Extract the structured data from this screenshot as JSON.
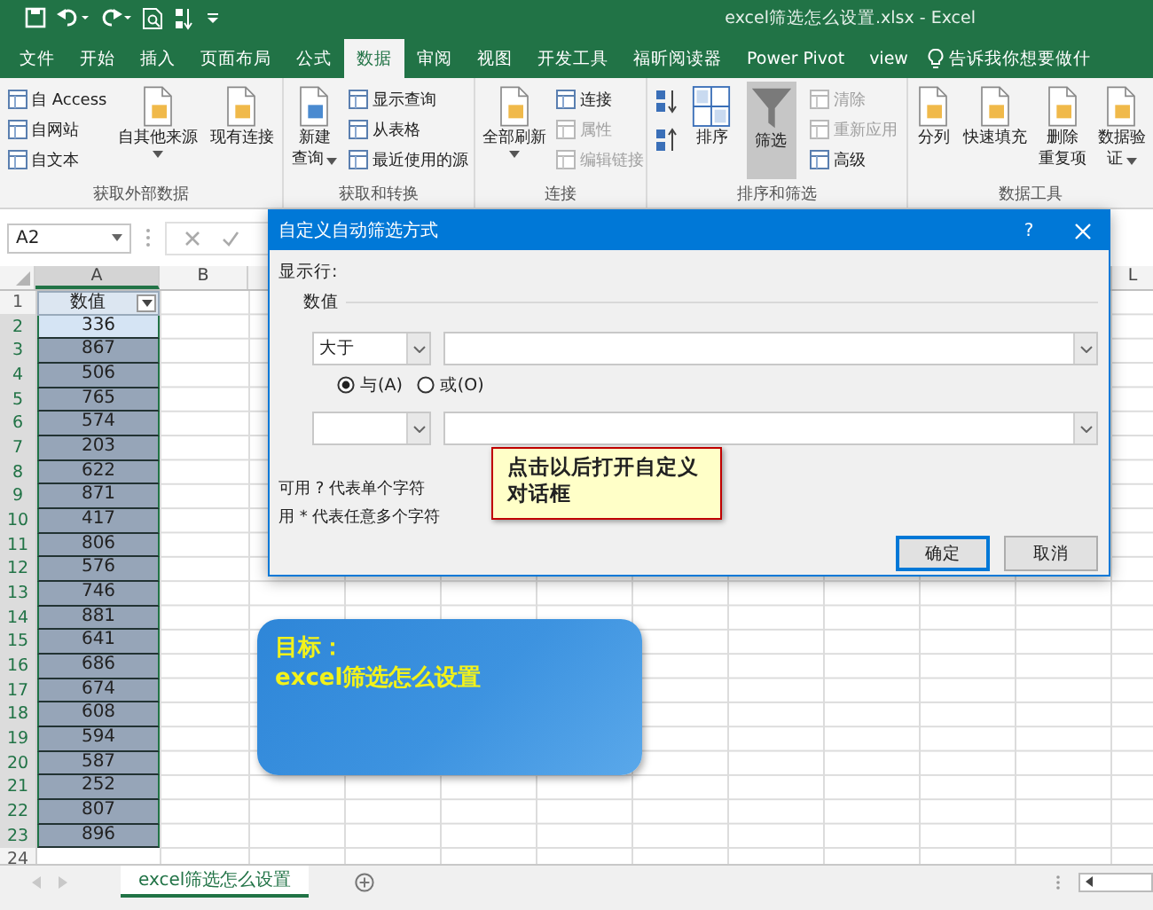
{
  "title": "excel筛选怎么设置.xlsx  -  Excel",
  "menu_tabs": [
    {
      "label": "文件",
      "selected": false
    },
    {
      "label": "开始",
      "selected": false
    },
    {
      "label": "插入",
      "selected": false
    },
    {
      "label": "页面布局",
      "selected": false
    },
    {
      "label": "公式",
      "selected": false
    },
    {
      "label": "数据",
      "selected": true
    },
    {
      "label": "审阅",
      "selected": false
    },
    {
      "label": "视图",
      "selected": false
    },
    {
      "label": "开发工具",
      "selected": false
    },
    {
      "label": "福昕阅读器",
      "selected": false
    },
    {
      "label": "Power Pivot",
      "selected": false
    },
    {
      "label": "view",
      "selected": false
    }
  ],
  "tell_me": "告诉我你想要做什",
  "ribbon_groups": [
    {
      "label": "获取外部数据",
      "buttons": [
        {
          "kind": "small",
          "lines": [
            "自 Access"
          ],
          "disabled": false
        },
        {
          "kind": "small",
          "lines": [
            "自网站"
          ],
          "disabled": false
        },
        {
          "kind": "small",
          "lines": [
            "自文本"
          ],
          "disabled": false
        },
        {
          "kind": "large",
          "lines": [
            "自其他来源"
          ],
          "dropdown": true,
          "disabled": false
        },
        {
          "kind": "large",
          "lines": [
            "现有连接"
          ],
          "disabled": false
        }
      ]
    },
    {
      "label": "获取和转换",
      "buttons": [
        {
          "kind": "large",
          "lines": [
            "新建",
            "查询"
          ],
          "dropdown": true,
          "disabled": false
        },
        {
          "kind": "small",
          "lines": [
            "显示查询"
          ],
          "disabled": false
        },
        {
          "kind": "small",
          "lines": [
            "从表格"
          ],
          "disabled": false
        },
        {
          "kind": "small",
          "lines": [
            "最近使用的源"
          ],
          "disabled": false
        }
      ]
    },
    {
      "label": "连接",
      "buttons": [
        {
          "kind": "large",
          "lines": [
            "全部刷新"
          ],
          "dropdown": true,
          "disabled": false
        },
        {
          "kind": "small",
          "lines": [
            "连接"
          ],
          "disabled": false
        },
        {
          "kind": "small",
          "lines": [
            "属性"
          ],
          "disabled": true
        },
        {
          "kind": "small",
          "lines": [
            "编辑链接"
          ],
          "disabled": true
        }
      ]
    },
    {
      "label": "排序和筛选",
      "buttons": [
        {
          "kind": "sort-pair"
        },
        {
          "kind": "sort",
          "lines": [
            "排序"
          ],
          "disabled": false
        },
        {
          "kind": "filter",
          "lines": [
            "筛选"
          ],
          "selected": true,
          "disabled": false
        },
        {
          "kind": "small",
          "lines": [
            "清除"
          ],
          "disabled": true
        },
        {
          "kind": "small",
          "lines": [
            "重新应用"
          ],
          "disabled": true
        },
        {
          "kind": "small",
          "lines": [
            "高级"
          ],
          "disabled": false
        }
      ]
    },
    {
      "label": "数据工具",
      "buttons": [
        {
          "kind": "large",
          "lines": [
            "分列"
          ],
          "disabled": false
        },
        {
          "kind": "large",
          "lines": [
            "快速填充"
          ],
          "disabled": false
        },
        {
          "kind": "large",
          "lines": [
            "删除",
            "重复项"
          ],
          "disabled": false
        },
        {
          "kind": "large",
          "lines": [
            "数据验",
            "证"
          ],
          "dropdown": true,
          "disabled": false
        }
      ]
    }
  ],
  "name_box": "A2",
  "columns": [
    {
      "label": "A",
      "selected": true
    },
    {
      "label": "B",
      "selected": false
    },
    {
      "label": "L",
      "selected": false
    }
  ],
  "rows": [
    {
      "num": "1",
      "kind": "header",
      "value": "数值",
      "selected": false
    },
    {
      "num": "2",
      "value": "336",
      "selected": true,
      "active": true
    },
    {
      "num": "3",
      "value": "867",
      "selected": true
    },
    {
      "num": "4",
      "value": "506",
      "selected": true
    },
    {
      "num": "5",
      "value": "765",
      "selected": true
    },
    {
      "num": "6",
      "value": "574",
      "selected": true
    },
    {
      "num": "7",
      "value": "203",
      "selected": true
    },
    {
      "num": "8",
      "value": "622",
      "selected": true
    },
    {
      "num": "9",
      "value": "871",
      "selected": true
    },
    {
      "num": "10",
      "value": "417",
      "selected": true
    },
    {
      "num": "11",
      "value": "806",
      "selected": true
    },
    {
      "num": "12",
      "value": "576",
      "selected": true
    },
    {
      "num": "13",
      "value": "746",
      "selected": true
    },
    {
      "num": "14",
      "value": "881",
      "selected": true
    },
    {
      "num": "15",
      "value": "641",
      "selected": true
    },
    {
      "num": "16",
      "value": "686",
      "selected": true
    },
    {
      "num": "17",
      "value": "674",
      "selected": true
    },
    {
      "num": "18",
      "value": "608",
      "selected": true
    },
    {
      "num": "19",
      "value": "594",
      "selected": true
    },
    {
      "num": "20",
      "value": "587",
      "selected": true
    },
    {
      "num": "21",
      "value": "252",
      "selected": true
    },
    {
      "num": "22",
      "value": "807",
      "selected": true
    },
    {
      "num": "23",
      "value": "896",
      "selected": true
    },
    {
      "num": "24",
      "selected": false
    }
  ],
  "dialog": {
    "title": "自定义自动筛选方式",
    "help": "?",
    "show_rows_label": "显示行:",
    "field_label": "数值",
    "condition_1": {
      "operator": "大于"
    },
    "joins": [
      {
        "label": "与(A)",
        "selected": true
      },
      {
        "label": "或(O)",
        "selected": false
      }
    ],
    "hints": [
      "可用 ? 代表单个字符",
      "用 * 代表任意多个字符"
    ],
    "buttons": [
      {
        "label": "确定",
        "default": true
      },
      {
        "label": "取消",
        "default": false
      }
    ]
  },
  "callout": "点击以后打开自定义对话框",
  "goal_box": {
    "title": "目标：",
    "text": "excel筛选怎么设置"
  },
  "sheet_tabs": [
    {
      "label": "excel筛选怎么设置",
      "selected": true
    }
  ]
}
